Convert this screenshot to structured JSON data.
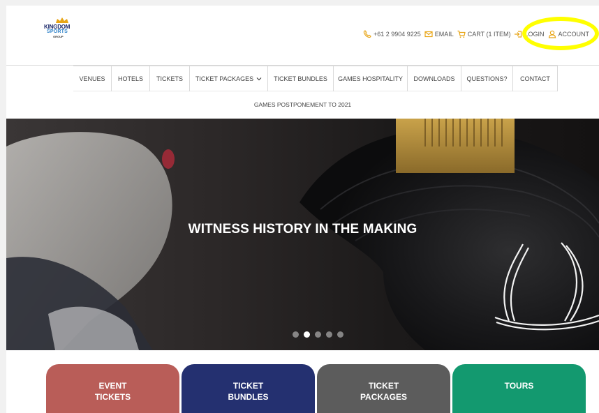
{
  "brand": {
    "line1": "KINGDOM",
    "line2": "SPORTS",
    "line3": "GROUP"
  },
  "topbar": {
    "phone": "+61 2 9904 9225",
    "email": "EMAIL",
    "cart": "CART (1 ITEM)",
    "login": "LOGIN",
    "account": "ACCOUNT"
  },
  "nav": {
    "items": [
      {
        "label": "VENUES"
      },
      {
        "label": "HOTELS"
      },
      {
        "label": "TICKETS"
      },
      {
        "label": "TICKET PACKAGES"
      },
      {
        "label": "TICKET BUNDLES"
      },
      {
        "label": "GAMES HOSPITALITY"
      },
      {
        "label": "DOWNLOADS"
      },
      {
        "label": "QUESTIONS?"
      },
      {
        "label": "CONTACT"
      }
    ],
    "sub_item": "GAMES POSTPONEMENT TO 2021"
  },
  "hero": {
    "title": "WITNESS HISTORY IN THE MAKING",
    "slides_total": 5,
    "active_slide": 2
  },
  "cards": [
    {
      "line1": "EVENT",
      "line2": "TICKETS",
      "color": "#b95d58"
    },
    {
      "line1": "TICKET",
      "line2": "BUNDLES",
      "color": "#243070"
    },
    {
      "line1": "TICKET",
      "line2": "PACKAGES",
      "color": "#5c5c5c"
    },
    {
      "line1": "TOURS",
      "line2": "",
      "color": "#13996f"
    }
  ],
  "colors": {
    "accent": "#e8a516",
    "highlight": "#ffff00",
    "text": "#444444"
  }
}
